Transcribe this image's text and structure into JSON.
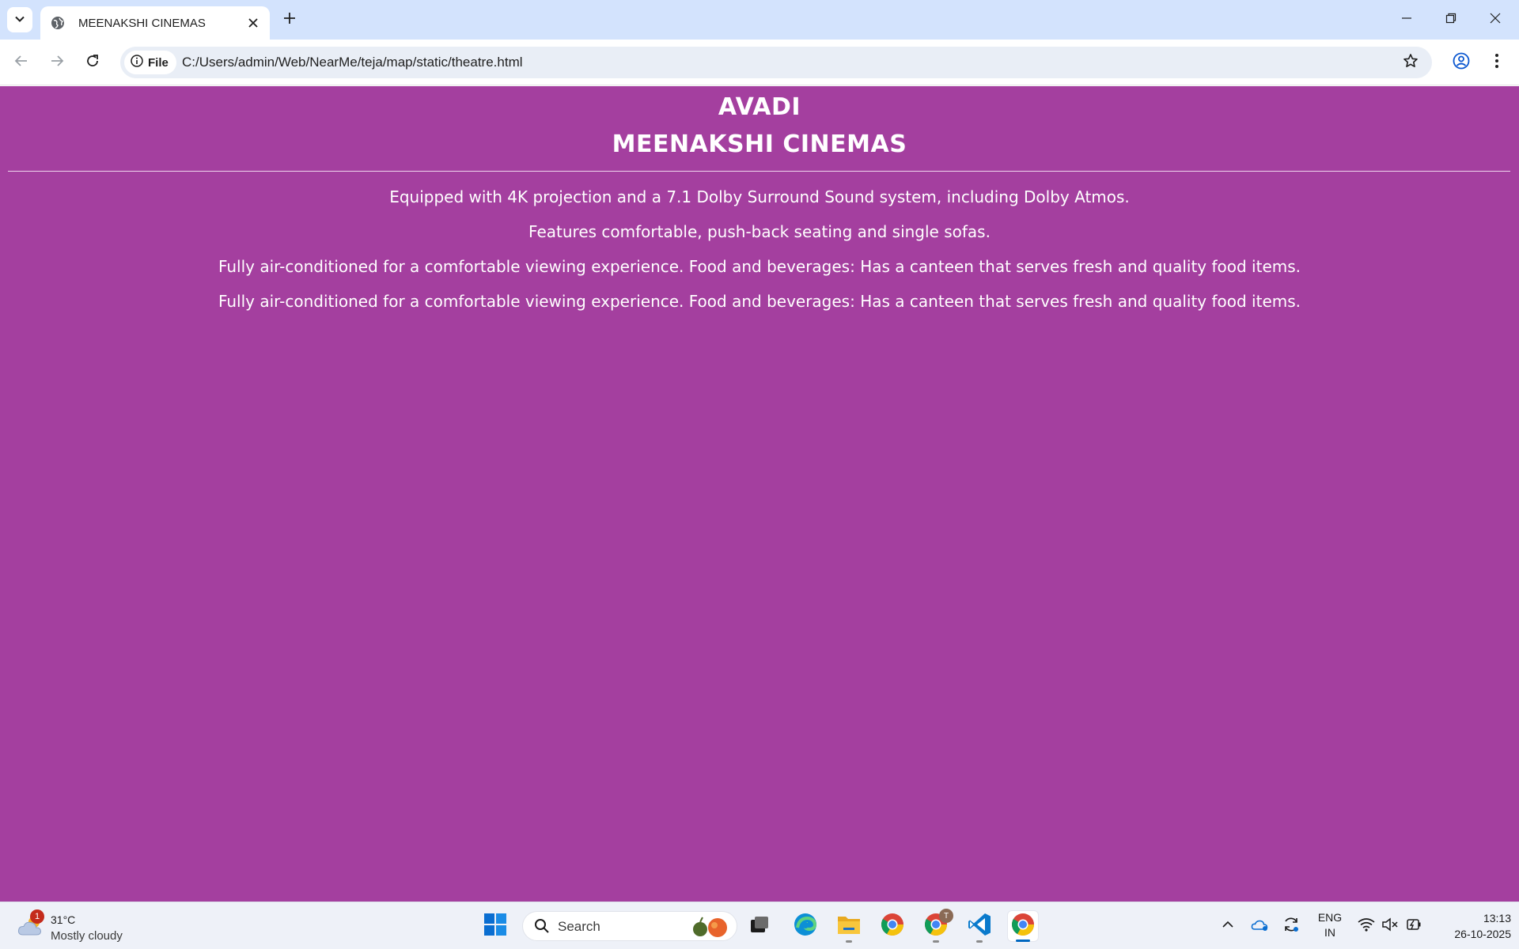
{
  "browser": {
    "tab_title": "MEENAKSHI CINEMAS",
    "site_chip_label": "File",
    "url": "C:/Users/admin/Web/NearMe/teja/map/static/theatre.html",
    "icons": [
      "tab-search-icon",
      "globe-icon",
      "close-icon",
      "plus-icon",
      "minimize-icon",
      "restore-icon",
      "back-icon",
      "forward-icon",
      "reload-icon",
      "info-icon",
      "star-icon",
      "profile-icon",
      "more-icon"
    ]
  },
  "page": {
    "background_color": "#a43f9f",
    "text_color": "#ffffff",
    "city": "AVADI",
    "cinema_name": "MEENAKSHI CINEMAS",
    "features": [
      "Equipped with 4K projection and a 7.1 Dolby Surround Sound system, including Dolby Atmos.",
      "Features comfortable, push-back seating and single sofas.",
      "Fully air-conditioned for a comfortable viewing experience. Food and beverages: Has a canteen that serves fresh and quality food items.",
      "Fully air-conditioned for a comfortable viewing experience. Food and beverages: Has a canteen that serves fresh and quality food items."
    ]
  },
  "taskbar": {
    "weather_badge": "1",
    "weather_temp": "31°C",
    "weather_desc": "Mostly cloudy",
    "search_label": "Search",
    "lang_line1": "ENG",
    "lang_line2": "IN",
    "time": "13:13",
    "date": "26-10-2025",
    "chrome_badge": "T",
    "apps": [
      "start-icon",
      "task-view-icon",
      "edge-icon",
      "file-explorer-icon",
      "chrome-icon",
      "chrome-profile-icon",
      "vscode-icon",
      "chrome-active-icon"
    ],
    "tray": [
      "chevron-up-icon",
      "onedrive-icon",
      "sync-icon",
      "wifi-icon",
      "volume-muted-icon",
      "battery-icon"
    ]
  }
}
